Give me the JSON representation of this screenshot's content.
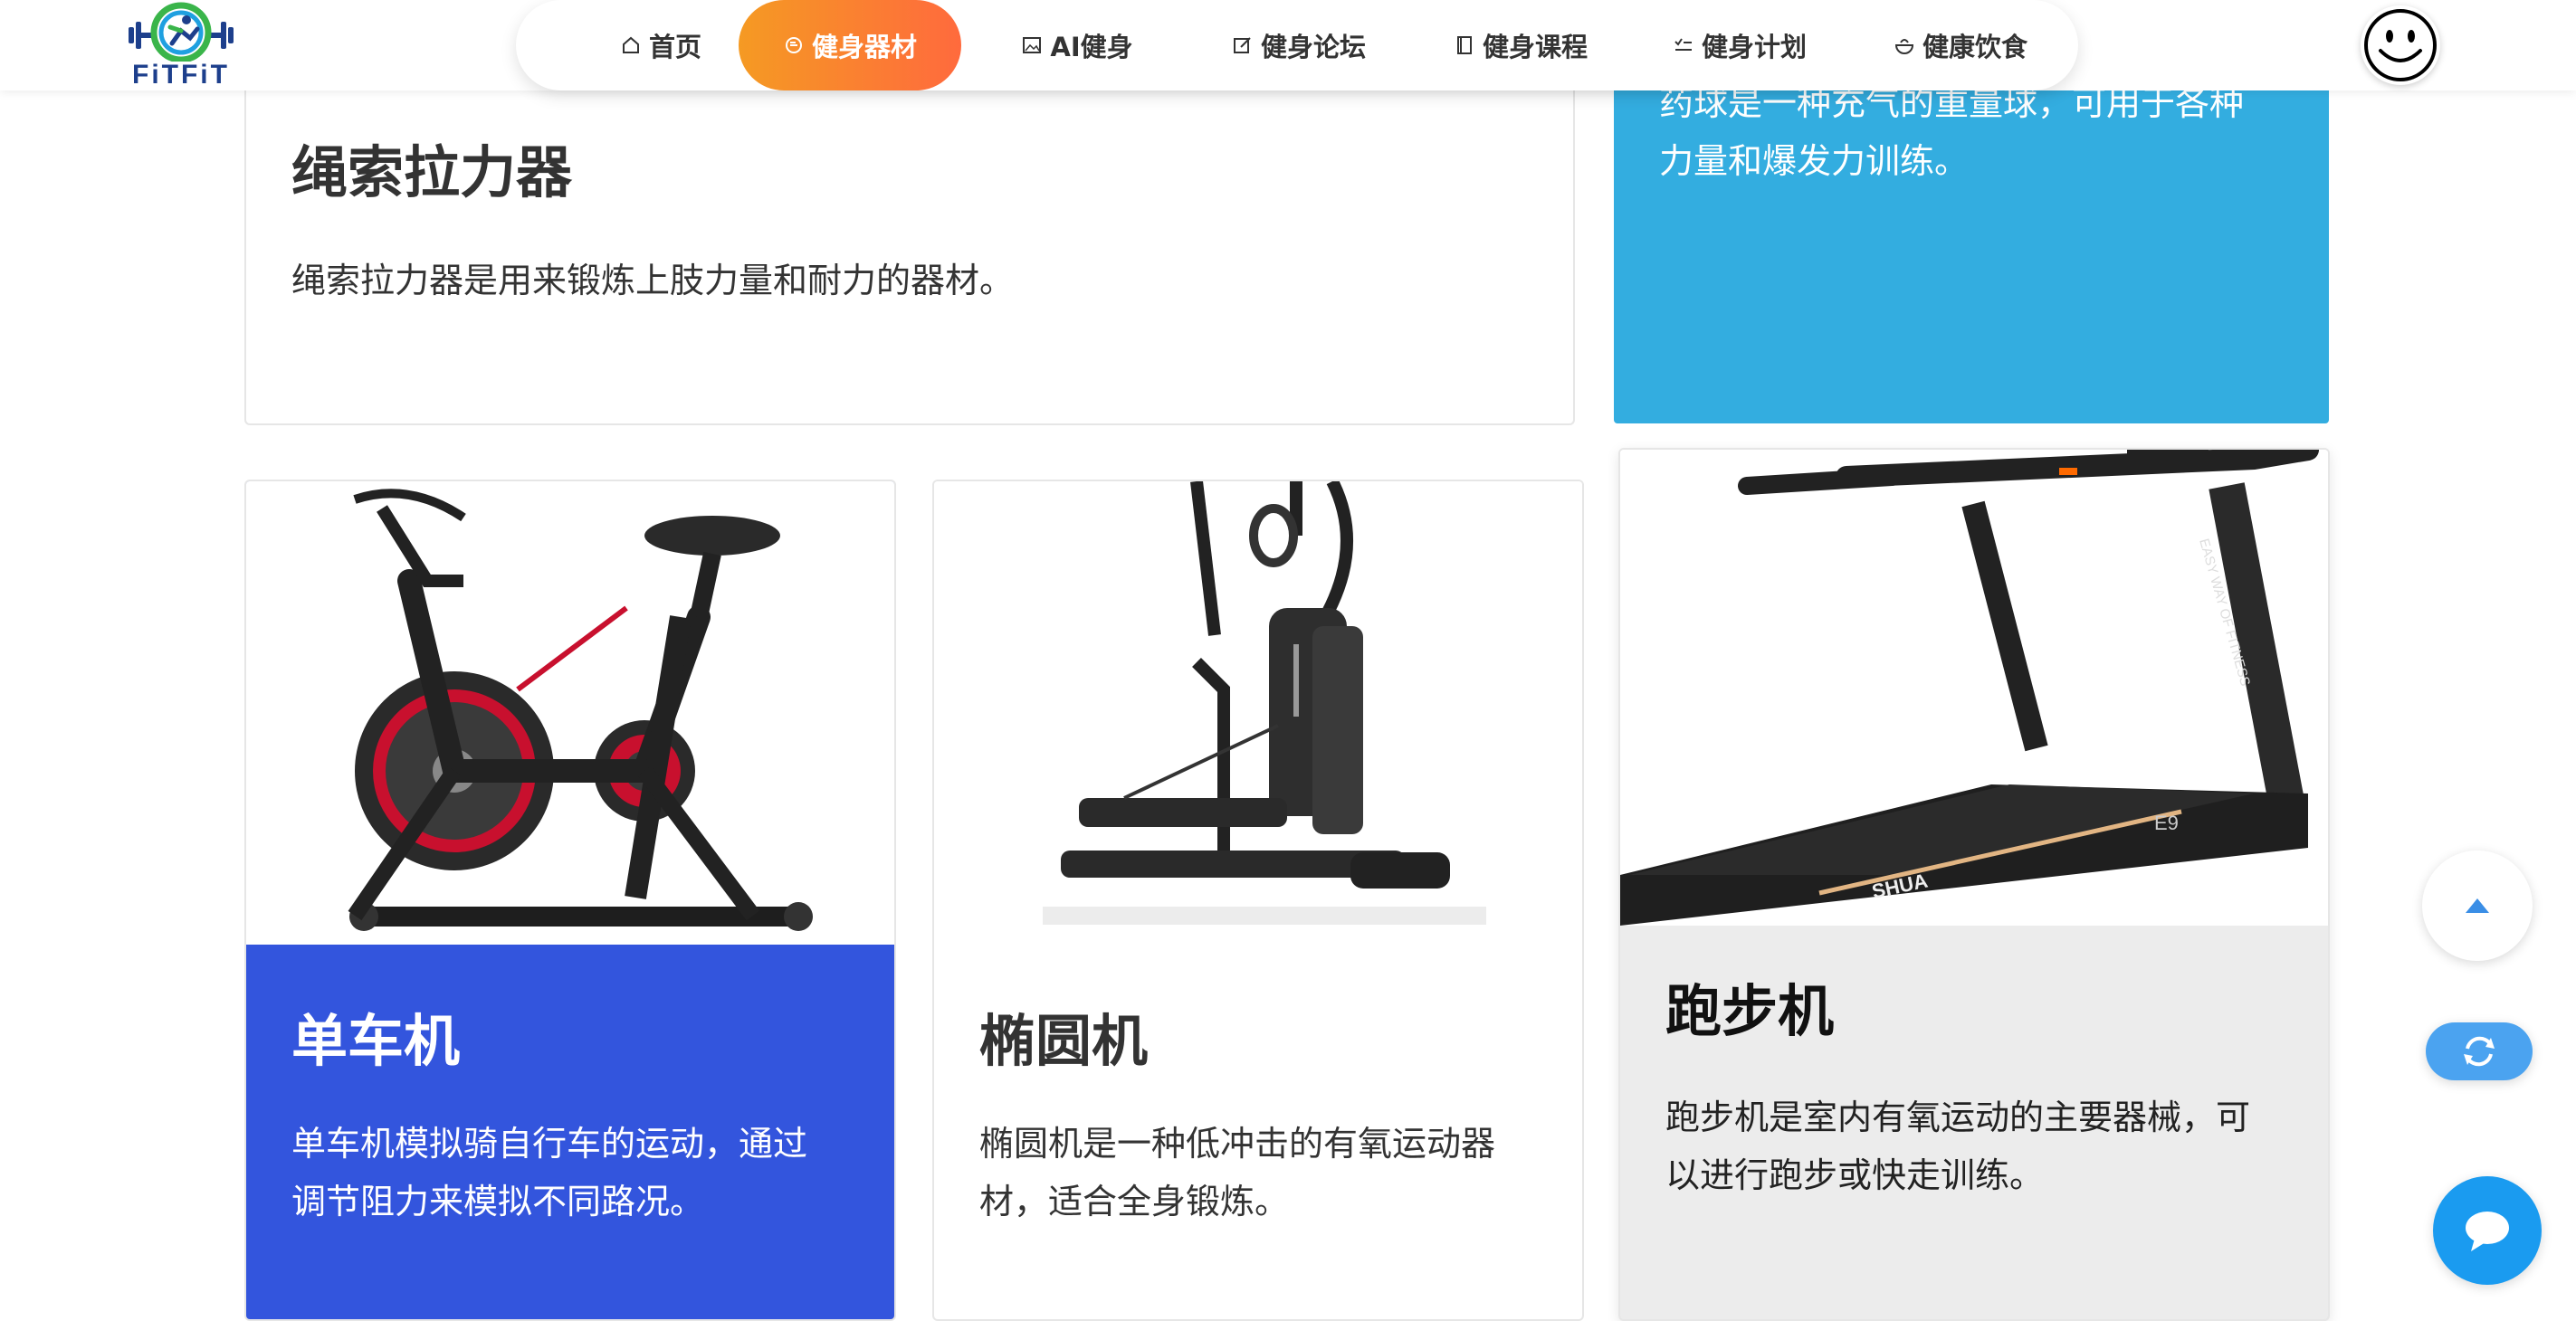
{
  "brand": {
    "logo_text": "FiTFiT"
  },
  "nav": {
    "items": [
      {
        "label": "首页",
        "icon": "home-icon"
      },
      {
        "label": "健身器材",
        "icon": "chat-icon",
        "active": true
      },
      {
        "label": "AI健身",
        "icon": "image-icon"
      },
      {
        "label": "健身论坛",
        "icon": "edit-icon"
      },
      {
        "label": "健身课程",
        "icon": "book-icon"
      },
      {
        "label": "健身计划",
        "icon": "checklist-icon"
      },
      {
        "label": "健康饮食",
        "icon": "food-icon"
      }
    ],
    "active_gradient": [
      "#f59a23",
      "#ff6a3d"
    ]
  },
  "cards": {
    "rope": {
      "title": "绳索拉力器",
      "desc": "绳索拉力器是用来锻炼上肢力量和耐力的器材。"
    },
    "medball": {
      "desc_line1": "药球是一种充气的重量球，可用于各种",
      "desc_line2": "力量和爆发力训练。",
      "color": "#33ade0"
    },
    "bike": {
      "title": "单车机",
      "desc_line1": "单车机模拟骑自行车的运动，通过",
      "desc_line2": "调节阻力来模拟不同路况。",
      "color": "#3355dd"
    },
    "elliptical": {
      "title": "椭圆机",
      "desc_line1": "椭圆机是一种低冲击的有氧运动器",
      "desc_line2": "材，适合全身锻炼。"
    },
    "treadmill": {
      "title": "跑步机",
      "desc_line1": "跑步机是室内有氧运动的主要器械，可",
      "desc_line2": "以进行跑步或快走训练。",
      "brand_text": "SHUA",
      "side_text": "EASY WAY OF FITNESS",
      "model_text": "E9"
    }
  },
  "floating": {
    "top_icon": "arrow-up-icon",
    "refresh_icon": "refresh-icon",
    "chat_icon": "chat-bubble-icon"
  }
}
